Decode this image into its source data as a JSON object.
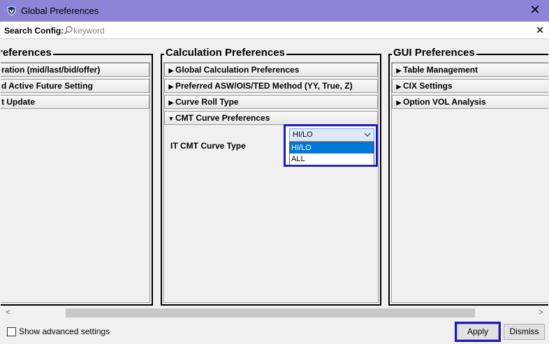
{
  "window": {
    "title": "Global Preferences"
  },
  "search": {
    "label": "Search Config:",
    "placeholder": "keyword",
    "value": ""
  },
  "panels": [
    {
      "title": "Preferences",
      "items": [
        {
          "label": "ration (mid/last/bid/offer)",
          "expanded": false
        },
        {
          "label": "d Active Future Setting",
          "expanded": false
        },
        {
          "label": "t Update",
          "expanded": false
        }
      ]
    },
    {
      "title": "Calculation Preferences",
      "items": [
        {
          "label": "Global Calculation Preferences",
          "expanded": false
        },
        {
          "label": "Preferred ASW/OIS/TED Method (YY, True, Z)",
          "expanded": false
        },
        {
          "label": "Curve Roll Type",
          "expanded": false
        },
        {
          "label": "CMT Curve Preferences",
          "expanded": true
        }
      ],
      "cmt": {
        "field_label": "IT CMT Curve Type",
        "selected": "HI/LO",
        "options": [
          "HI/LO",
          "ALL"
        ],
        "highlighted": "HI/LO"
      }
    },
    {
      "title": "GUI Preferences",
      "items": [
        {
          "label": "Table Management",
          "expanded": false
        },
        {
          "label": "CIX Settings",
          "expanded": false
        },
        {
          "label": "Option VOL Analysis",
          "expanded": false
        }
      ]
    }
  ],
  "footer": {
    "show_advanced_label": "Show advanced settings",
    "show_advanced_checked": false,
    "apply_label": "Apply",
    "dismiss_label": "Dismiss"
  },
  "colors": {
    "titlebar": "#8b84d7",
    "highlight_border": "#1a1acd",
    "selection": "#0078d7"
  }
}
